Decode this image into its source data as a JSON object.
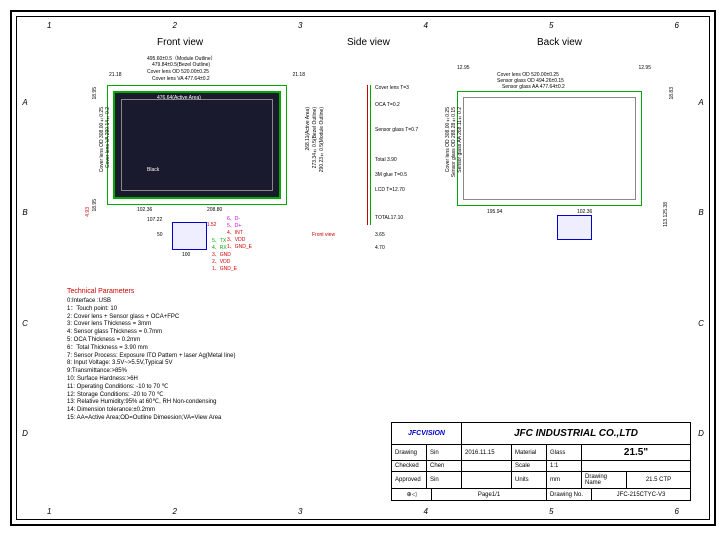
{
  "ruler_cols": [
    "1",
    "2",
    "3",
    "4",
    "5",
    "6"
  ],
  "ruler_rows": [
    "A",
    "B",
    "C",
    "D"
  ],
  "views": {
    "front": "Front view",
    "side": "Side view",
    "back": "Back view"
  },
  "front": {
    "module_outline": "495.60±0.5（Module Outline）",
    "bezel_outline": "479.84±0.5(Bezel Outline)",
    "cover_lens_od": "Cover lens OD 520.00±0.25",
    "cover_lens_va": "Cover lens VA 477.64±0.2",
    "active_area": "476.64(Active Area)",
    "black": "Black",
    "dim_2118_l": "21.18",
    "dim_2118_r": "21.18",
    "dim_1895_t": "18.95",
    "dim_1895_b": "18.95",
    "cover_od_v": "Cover lens OD 308.00±0.25",
    "cover_va_v": "Cover lens VA 290.14±0.2",
    "bezel_v": "273.34±0.5(Bezel Outline)",
    "module_v": "290.23±0.5(Module Outline)",
    "active_v": "268.11(Active Area)",
    "dim_10236": "102.36",
    "dim_20880": "208.80",
    "dim_10722": "107.22",
    "dim_50": "50",
    "dim_100": "100",
    "dim_493": "4.93",
    "dim_38152": "3.8±1.52",
    "front_view_arrow": "Front view"
  },
  "pins_right": [
    "6、D-",
    "5、D+",
    "4、INT",
    "3、VDD",
    "1、GND_E"
  ],
  "pins_left": [
    "5、TX",
    "4、RX",
    "3、GND",
    "2、VDD",
    "1、GND_E"
  ],
  "side": {
    "cover_lens": "Cover lens T=3",
    "oca": "OCA T=0.2",
    "sensor": "Sensor glass T=0.7",
    "total390": "Total 3.90",
    "glue": "3M glue T=0.5",
    "lcd": "LCD T=12.70",
    "total1710": "TOTAL17.10",
    "dim_365": "3.65",
    "dim_470": "4.70"
  },
  "back": {
    "dim_1295_l": "12.95",
    "dim_1295_r": "12.95",
    "cover_od": "Cover lens OD 520.00±0.25",
    "sensor_od": "Sensor glass OD 494.26±0.15",
    "sensor_va": "Sensor glass AA 477.64±0.2",
    "cover_od_v": "Cover lens OD 308.00±0.25",
    "sensor_od_v": "Sensor glass OD 288.28±0.15",
    "sensor_aa_v": "Sensor glass AA 268.11±0.2",
    "dim_19594": "195.94",
    "dim_10236": "102.36",
    "dim_11312": "113.12",
    "dim_1883": "18.83",
    "dim_538": "5.38"
  },
  "tech": {
    "title": "Technical Parameters",
    "items": [
      "0:Interface :USB",
      "1：Touch point: 10",
      "2: Cover lens + Sensor glass + OCA+FPC",
      "3: Cover lens Thickness = 3mm",
      "4: Sensor glass Thickness = 0.7mm",
      "5: OCA Thickness = 0.2mm",
      "6：Total Thickness = 3.90 mm",
      "7: Sensor Process:  Exposure ITO Pattern + laser Ag(Metal line)",
      "8: Input Voltage: 3.5V~>5.5V,Typical 5V",
      "9:Transmittance:>85%",
      "10: Surface Hardness:>6H",
      "11: Operating Conditions: -10 to 70 ℃",
      "12: Storage Conditions: -20 to 70 ℃",
      "13: Relative Humidity:95% at 60℃, RH Non-condensing",
      "14: Dimension tolerance:±0.2mm",
      "15: AA=Active Area;OD=Outline Dimeesion;VA=View Area"
    ]
  },
  "title_block": {
    "logo": "JFCVISION",
    "company": "JFC INDUSTRIAL CO.,LTD",
    "drawing": "Drawing",
    "checked": "Checked",
    "approved": "Approved",
    "sin": "Sin",
    "chen": "Chen",
    "date": "2016.11.15",
    "material": "Material",
    "glass": "Glass",
    "scale": "Scale",
    "scale_v": "1:1",
    "units": "Units",
    "units_v": "mm",
    "size": "21.5\"",
    "drawing_name": "Drawing Name",
    "drawing_name_v": "21.5 CTP",
    "drawing_no": "Drawing No.",
    "drawing_no_v": "JFC-215CTYC-V3",
    "page": "Page1/1"
  }
}
